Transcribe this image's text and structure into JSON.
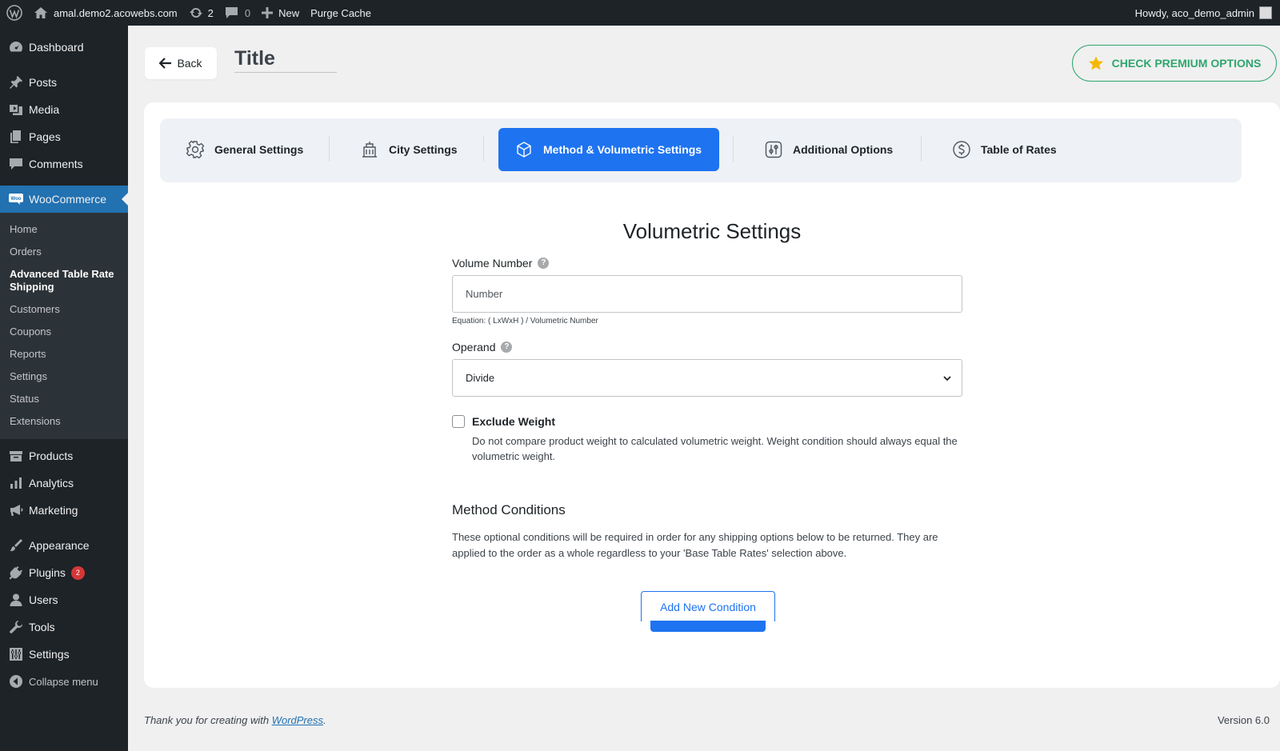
{
  "admin_bar": {
    "site_name": "amal.demo2.acowebs.com",
    "updates_count": "2",
    "comments_count": "0",
    "new_label": "New",
    "purge_cache_label": "Purge Cache",
    "howdy": "Howdy, aco_demo_admin"
  },
  "sidebar": {
    "dashboard": "Dashboard",
    "posts": "Posts",
    "media": "Media",
    "pages": "Pages",
    "comments": "Comments",
    "woocommerce": "WooCommerce",
    "woo_submenu": [
      "Home",
      "Orders",
      "Advanced Table Rate Shipping",
      "Customers",
      "Coupons",
      "Reports",
      "Settings",
      "Status",
      "Extensions"
    ],
    "products": "Products",
    "analytics": "Analytics",
    "marketing": "Marketing",
    "appearance": "Appearance",
    "plugins": "Plugins",
    "plugins_badge": "2",
    "users": "Users",
    "tools": "Tools",
    "settings": "Settings",
    "collapse": "Collapse menu"
  },
  "header": {
    "back_label": "Back",
    "title_value": "Title",
    "premium_label": "CHECK PREMIUM OPTIONS"
  },
  "tabs": [
    {
      "label": "General Settings",
      "icon": "gear-icon"
    },
    {
      "label": "City Settings",
      "icon": "building-icon"
    },
    {
      "label": "Method & Volumetric Settings",
      "icon": "box-icon",
      "active": true
    },
    {
      "label": "Additional Options",
      "icon": "sliders-icon"
    },
    {
      "label": "Table of Rates",
      "icon": "dollar-icon"
    }
  ],
  "volumetric": {
    "heading": "Volumetric Settings",
    "volume_number_label": "Volume Number",
    "volume_number_placeholder": "Number",
    "equation_hint": "Equation: ( LxWxH ) / Volumetric Number",
    "operand_label": "Operand",
    "operand_value": "Divide",
    "exclude_weight_label": "Exclude Weight",
    "exclude_weight_checked": false,
    "exclude_weight_desc": "Do not compare product weight to calculated volumetric weight. Weight condition should always equal the volumetric weight."
  },
  "method_conditions": {
    "heading": "Method Conditions",
    "description": "These optional conditions will be required in order for any shipping options below to be returned. They are applied to the order as a whole regardless to your 'Base Table Rates' selection above.",
    "add_button": "Add New Condition"
  },
  "footer": {
    "thanks_prefix": "Thank you for creating with ",
    "wordpress_link": "WordPress",
    "thanks_suffix": ".",
    "version": "Version 6.0"
  },
  "colors": {
    "accent_blue": "#1e73f0",
    "wp_blue": "#2271b1",
    "premium_green": "#2fa66c",
    "star_yellow": "#f5b800"
  }
}
